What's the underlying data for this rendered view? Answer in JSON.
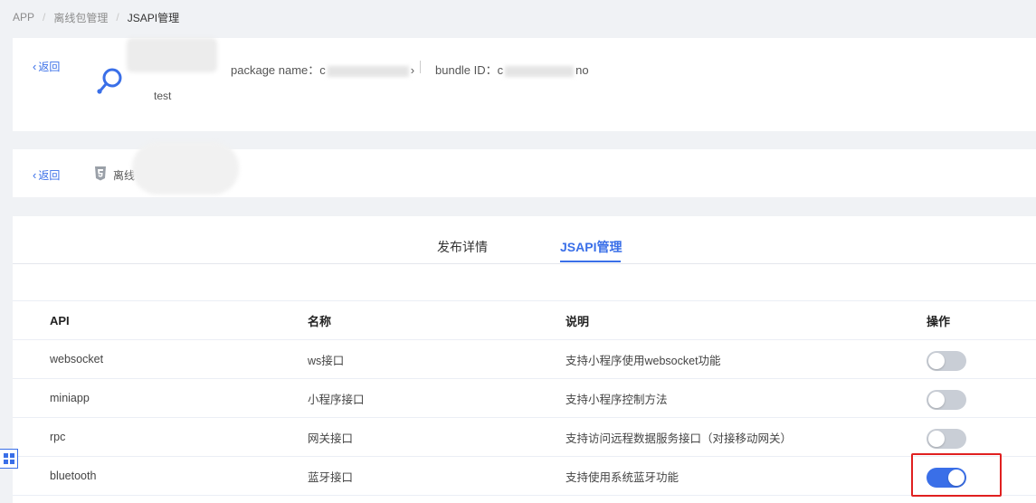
{
  "breadcrumb": [
    "APP",
    "离线包管理",
    "JSAPI管理"
  ],
  "app_card": {
    "back_label": "返回",
    "app_name": "test",
    "package_name_label": "package name：",
    "package_name_prefix": "c",
    "package_name_suffix": "›",
    "bundle_id_label": "bundle ID：",
    "bundle_id_prefix": "c",
    "bundle_id_suffix": "no"
  },
  "package_card": {
    "back_label": "返回",
    "package_label": "离线"
  },
  "tabs": [
    {
      "label": "发布详情",
      "active": false
    },
    {
      "label": "JSAPI管理",
      "active": true
    }
  ],
  "table": {
    "headers": [
      "API",
      "名称",
      "说明",
      "操作"
    ],
    "rows": [
      {
        "api": "websocket",
        "name": "ws接口",
        "desc": "支持小程序使用websocket功能",
        "enabled": false
      },
      {
        "api": "miniapp",
        "name": "小程序接口",
        "desc": "支持小程序控制方法",
        "enabled": false
      },
      {
        "api": "rpc",
        "name": "网关接口",
        "desc": "支持访问远程数据服务接口（对接移动网关）",
        "enabled": false
      },
      {
        "api": "bluetooth",
        "name": "蓝牙接口",
        "desc": "支持使用系统蓝牙功能",
        "enabled": true
      }
    ]
  },
  "colors": {
    "accent": "#3a6fe8",
    "highlight": "#e02020",
    "switch_off": "#c9ced6"
  }
}
